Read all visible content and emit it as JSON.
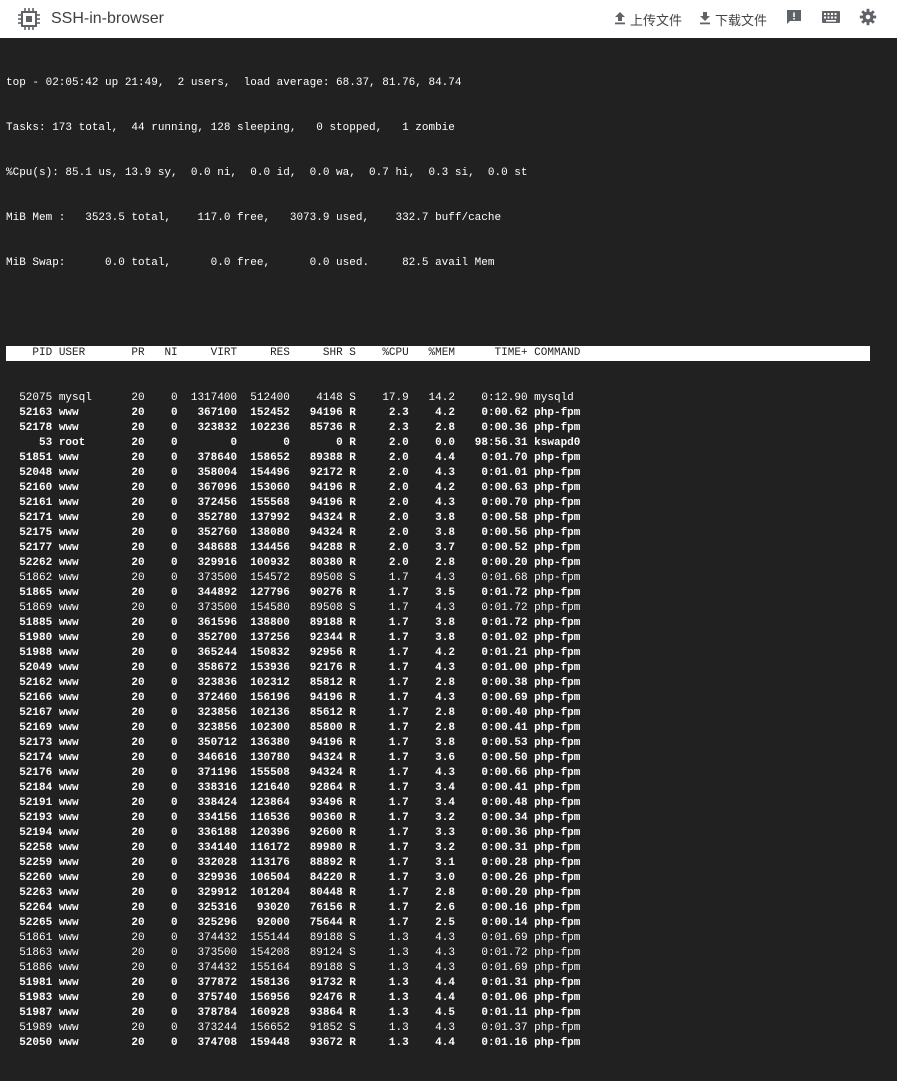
{
  "app": {
    "title": "SSH-in-browser"
  },
  "toolbar": {
    "upload_label": "上传文件",
    "download_label": "下载文件",
    "icons": [
      "chip-icon",
      "upload-icon",
      "download-icon",
      "feedback-icon",
      "keyboard-icon",
      "settings-icon"
    ]
  },
  "top": {
    "summary": [
      "top - 02:05:42 up 21:49,  2 users,  load average: 68.37, 81.76, 84.74",
      "Tasks: 173 total,  44 running, 128 sleeping,   0 stopped,   1 zombie",
      "%Cpu(s): 85.1 us, 13.9 sy,  0.0 ni,  0.0 id,  0.0 wa,  0.7 hi,  0.3 si,  0.0 st",
      "MiB Mem :   3523.5 total,    117.0 free,   3073.9 used,    332.7 buff/cache",
      "MiB Swap:      0.0 total,      0.0 free,      0.0 used.     82.5 avail Mem"
    ],
    "columns": [
      "PID",
      "USER",
      "PR",
      "NI",
      "VIRT",
      "RES",
      "SHR",
      "S",
      "%CPU",
      "%MEM",
      "TIME+",
      "COMMAND"
    ],
    "processes": [
      {
        "pid": "52075",
        "user": "mysql",
        "pr": "20",
        "ni": "0",
        "virt": "1317400",
        "res": "512400",
        "shr": "4148",
        "s": "S",
        "cpu": "17.9",
        "mem": "14.2",
        "time": "0:12.90",
        "cmd": "mysqld"
      },
      {
        "pid": "52163",
        "user": "www",
        "pr": "20",
        "ni": "0",
        "virt": "367100",
        "res": "152452",
        "shr": "94196",
        "s": "R",
        "cpu": "2.3",
        "mem": "4.2",
        "time": "0:00.62",
        "cmd": "php-fpm"
      },
      {
        "pid": "52178",
        "user": "www",
        "pr": "20",
        "ni": "0",
        "virt": "323832",
        "res": "102236",
        "shr": "85736",
        "s": "R",
        "cpu": "2.3",
        "mem": "2.8",
        "time": "0:00.36",
        "cmd": "php-fpm"
      },
      {
        "pid": "53",
        "user": "root",
        "pr": "20",
        "ni": "0",
        "virt": "0",
        "res": "0",
        "shr": "0",
        "s": "R",
        "cpu": "2.0",
        "mem": "0.0",
        "time": "98:56.31",
        "cmd": "kswapd0"
      },
      {
        "pid": "51851",
        "user": "www",
        "pr": "20",
        "ni": "0",
        "virt": "378640",
        "res": "158652",
        "shr": "89388",
        "s": "R",
        "cpu": "2.0",
        "mem": "4.4",
        "time": "0:01.70",
        "cmd": "php-fpm"
      },
      {
        "pid": "52048",
        "user": "www",
        "pr": "20",
        "ni": "0",
        "virt": "358004",
        "res": "154496",
        "shr": "92172",
        "s": "R",
        "cpu": "2.0",
        "mem": "4.3",
        "time": "0:01.01",
        "cmd": "php-fpm"
      },
      {
        "pid": "52160",
        "user": "www",
        "pr": "20",
        "ni": "0",
        "virt": "367096",
        "res": "153060",
        "shr": "94196",
        "s": "R",
        "cpu": "2.0",
        "mem": "4.2",
        "time": "0:00.63",
        "cmd": "php-fpm"
      },
      {
        "pid": "52161",
        "user": "www",
        "pr": "20",
        "ni": "0",
        "virt": "372456",
        "res": "155568",
        "shr": "94196",
        "s": "R",
        "cpu": "2.0",
        "mem": "4.3",
        "time": "0:00.70",
        "cmd": "php-fpm"
      },
      {
        "pid": "52171",
        "user": "www",
        "pr": "20",
        "ni": "0",
        "virt": "352780",
        "res": "137992",
        "shr": "94324",
        "s": "R",
        "cpu": "2.0",
        "mem": "3.8",
        "time": "0:00.58",
        "cmd": "php-fpm"
      },
      {
        "pid": "52175",
        "user": "www",
        "pr": "20",
        "ni": "0",
        "virt": "352760",
        "res": "138080",
        "shr": "94324",
        "s": "R",
        "cpu": "2.0",
        "mem": "3.8",
        "time": "0:00.56",
        "cmd": "php-fpm"
      },
      {
        "pid": "52177",
        "user": "www",
        "pr": "20",
        "ni": "0",
        "virt": "348688",
        "res": "134456",
        "shr": "94288",
        "s": "R",
        "cpu": "2.0",
        "mem": "3.7",
        "time": "0:00.52",
        "cmd": "php-fpm"
      },
      {
        "pid": "52262",
        "user": "www",
        "pr": "20",
        "ni": "0",
        "virt": "329916",
        "res": "100932",
        "shr": "80380",
        "s": "R",
        "cpu": "2.0",
        "mem": "2.8",
        "time": "0:00.20",
        "cmd": "php-fpm"
      },
      {
        "pid": "51862",
        "user": "www",
        "pr": "20",
        "ni": "0",
        "virt": "373500",
        "res": "154572",
        "shr": "89508",
        "s": "S",
        "cpu": "1.7",
        "mem": "4.3",
        "time": "0:01.68",
        "cmd": "php-fpm"
      },
      {
        "pid": "51865",
        "user": "www",
        "pr": "20",
        "ni": "0",
        "virt": "344892",
        "res": "127796",
        "shr": "90276",
        "s": "R",
        "cpu": "1.7",
        "mem": "3.5",
        "time": "0:01.72",
        "cmd": "php-fpm"
      },
      {
        "pid": "51869",
        "user": "www",
        "pr": "20",
        "ni": "0",
        "virt": "373500",
        "res": "154580",
        "shr": "89508",
        "s": "S",
        "cpu": "1.7",
        "mem": "4.3",
        "time": "0:01.72",
        "cmd": "php-fpm"
      },
      {
        "pid": "51885",
        "user": "www",
        "pr": "20",
        "ni": "0",
        "virt": "361596",
        "res": "138800",
        "shr": "89188",
        "s": "R",
        "cpu": "1.7",
        "mem": "3.8",
        "time": "0:01.72",
        "cmd": "php-fpm"
      },
      {
        "pid": "51980",
        "user": "www",
        "pr": "20",
        "ni": "0",
        "virt": "352700",
        "res": "137256",
        "shr": "92344",
        "s": "R",
        "cpu": "1.7",
        "mem": "3.8",
        "time": "0:01.02",
        "cmd": "php-fpm"
      },
      {
        "pid": "51988",
        "user": "www",
        "pr": "20",
        "ni": "0",
        "virt": "365244",
        "res": "150832",
        "shr": "92956",
        "s": "R",
        "cpu": "1.7",
        "mem": "4.2",
        "time": "0:01.21",
        "cmd": "php-fpm"
      },
      {
        "pid": "52049",
        "user": "www",
        "pr": "20",
        "ni": "0",
        "virt": "358672",
        "res": "153936",
        "shr": "92176",
        "s": "R",
        "cpu": "1.7",
        "mem": "4.3",
        "time": "0:01.00",
        "cmd": "php-fpm"
      },
      {
        "pid": "52162",
        "user": "www",
        "pr": "20",
        "ni": "0",
        "virt": "323836",
        "res": "102312",
        "shr": "85812",
        "s": "R",
        "cpu": "1.7",
        "mem": "2.8",
        "time": "0:00.38",
        "cmd": "php-fpm"
      },
      {
        "pid": "52166",
        "user": "www",
        "pr": "20",
        "ni": "0",
        "virt": "372460",
        "res": "156196",
        "shr": "94196",
        "s": "R",
        "cpu": "1.7",
        "mem": "4.3",
        "time": "0:00.69",
        "cmd": "php-fpm"
      },
      {
        "pid": "52167",
        "user": "www",
        "pr": "20",
        "ni": "0",
        "virt": "323856",
        "res": "102136",
        "shr": "85612",
        "s": "R",
        "cpu": "1.7",
        "mem": "2.8",
        "time": "0:00.40",
        "cmd": "php-fpm"
      },
      {
        "pid": "52169",
        "user": "www",
        "pr": "20",
        "ni": "0",
        "virt": "323856",
        "res": "102300",
        "shr": "85800",
        "s": "R",
        "cpu": "1.7",
        "mem": "2.8",
        "time": "0:00.41",
        "cmd": "php-fpm"
      },
      {
        "pid": "52173",
        "user": "www",
        "pr": "20",
        "ni": "0",
        "virt": "350712",
        "res": "136380",
        "shr": "94196",
        "s": "R",
        "cpu": "1.7",
        "mem": "3.8",
        "time": "0:00.53",
        "cmd": "php-fpm"
      },
      {
        "pid": "52174",
        "user": "www",
        "pr": "20",
        "ni": "0",
        "virt": "346616",
        "res": "130780",
        "shr": "94324",
        "s": "R",
        "cpu": "1.7",
        "mem": "3.6",
        "time": "0:00.50",
        "cmd": "php-fpm"
      },
      {
        "pid": "52176",
        "user": "www",
        "pr": "20",
        "ni": "0",
        "virt": "371196",
        "res": "155508",
        "shr": "94324",
        "s": "R",
        "cpu": "1.7",
        "mem": "4.3",
        "time": "0:00.66",
        "cmd": "php-fpm"
      },
      {
        "pid": "52184",
        "user": "www",
        "pr": "20",
        "ni": "0",
        "virt": "338316",
        "res": "121640",
        "shr": "92864",
        "s": "R",
        "cpu": "1.7",
        "mem": "3.4",
        "time": "0:00.41",
        "cmd": "php-fpm"
      },
      {
        "pid": "52191",
        "user": "www",
        "pr": "20",
        "ni": "0",
        "virt": "338424",
        "res": "123864",
        "shr": "93496",
        "s": "R",
        "cpu": "1.7",
        "mem": "3.4",
        "time": "0:00.48",
        "cmd": "php-fpm"
      },
      {
        "pid": "52193",
        "user": "www",
        "pr": "20",
        "ni": "0",
        "virt": "334156",
        "res": "116536",
        "shr": "90360",
        "s": "R",
        "cpu": "1.7",
        "mem": "3.2",
        "time": "0:00.34",
        "cmd": "php-fpm"
      },
      {
        "pid": "52194",
        "user": "www",
        "pr": "20",
        "ni": "0",
        "virt": "336188",
        "res": "120396",
        "shr": "92600",
        "s": "R",
        "cpu": "1.7",
        "mem": "3.3",
        "time": "0:00.36",
        "cmd": "php-fpm"
      },
      {
        "pid": "52258",
        "user": "www",
        "pr": "20",
        "ni": "0",
        "virt": "334140",
        "res": "116172",
        "shr": "89980",
        "s": "R",
        "cpu": "1.7",
        "mem": "3.2",
        "time": "0:00.31",
        "cmd": "php-fpm"
      },
      {
        "pid": "52259",
        "user": "www",
        "pr": "20",
        "ni": "0",
        "virt": "332028",
        "res": "113176",
        "shr": "88892",
        "s": "R",
        "cpu": "1.7",
        "mem": "3.1",
        "time": "0:00.28",
        "cmd": "php-fpm"
      },
      {
        "pid": "52260",
        "user": "www",
        "pr": "20",
        "ni": "0",
        "virt": "329936",
        "res": "106504",
        "shr": "84220",
        "s": "R",
        "cpu": "1.7",
        "mem": "3.0",
        "time": "0:00.26",
        "cmd": "php-fpm"
      },
      {
        "pid": "52263",
        "user": "www",
        "pr": "20",
        "ni": "0",
        "virt": "329912",
        "res": "101204",
        "shr": "80448",
        "s": "R",
        "cpu": "1.7",
        "mem": "2.8",
        "time": "0:00.20",
        "cmd": "php-fpm"
      },
      {
        "pid": "52264",
        "user": "www",
        "pr": "20",
        "ni": "0",
        "virt": "325316",
        "res": "93020",
        "shr": "76156",
        "s": "R",
        "cpu": "1.7",
        "mem": "2.6",
        "time": "0:00.16",
        "cmd": "php-fpm"
      },
      {
        "pid": "52265",
        "user": "www",
        "pr": "20",
        "ni": "0",
        "virt": "325296",
        "res": "92000",
        "shr": "75644",
        "s": "R",
        "cpu": "1.7",
        "mem": "2.5",
        "time": "0:00.14",
        "cmd": "php-fpm"
      },
      {
        "pid": "51861",
        "user": "www",
        "pr": "20",
        "ni": "0",
        "virt": "374432",
        "res": "155144",
        "shr": "89188",
        "s": "S",
        "cpu": "1.3",
        "mem": "4.3",
        "time": "0:01.69",
        "cmd": "php-fpm"
      },
      {
        "pid": "51863",
        "user": "www",
        "pr": "20",
        "ni": "0",
        "virt": "373500",
        "res": "154208",
        "shr": "89124",
        "s": "S",
        "cpu": "1.3",
        "mem": "4.3",
        "time": "0:01.72",
        "cmd": "php-fpm"
      },
      {
        "pid": "51886",
        "user": "www",
        "pr": "20",
        "ni": "0",
        "virt": "374432",
        "res": "155164",
        "shr": "89188",
        "s": "S",
        "cpu": "1.3",
        "mem": "4.3",
        "time": "0:01.69",
        "cmd": "php-fpm"
      },
      {
        "pid": "51981",
        "user": "www",
        "pr": "20",
        "ni": "0",
        "virt": "377872",
        "res": "158136",
        "shr": "91732",
        "s": "R",
        "cpu": "1.3",
        "mem": "4.4",
        "time": "0:01.31",
        "cmd": "php-fpm"
      },
      {
        "pid": "51983",
        "user": "www",
        "pr": "20",
        "ni": "0",
        "virt": "375740",
        "res": "156956",
        "shr": "92476",
        "s": "R",
        "cpu": "1.3",
        "mem": "4.4",
        "time": "0:01.06",
        "cmd": "php-fpm"
      },
      {
        "pid": "51987",
        "user": "www",
        "pr": "20",
        "ni": "0",
        "virt": "378784",
        "res": "160928",
        "shr": "93864",
        "s": "R",
        "cpu": "1.3",
        "mem": "4.5",
        "time": "0:01.11",
        "cmd": "php-fpm"
      },
      {
        "pid": "51989",
        "user": "www",
        "pr": "20",
        "ni": "0",
        "virt": "373244",
        "res": "156652",
        "shr": "91852",
        "s": "S",
        "cpu": "1.3",
        "mem": "4.3",
        "time": "0:01.37",
        "cmd": "php-fpm"
      },
      {
        "pid": "52050",
        "user": "www",
        "pr": "20",
        "ni": "0",
        "virt": "374708",
        "res": "159448",
        "shr": "93672",
        "s": "R",
        "cpu": "1.3",
        "mem": "4.4",
        "time": "0:01.16",
        "cmd": "php-fpm"
      }
    ]
  }
}
